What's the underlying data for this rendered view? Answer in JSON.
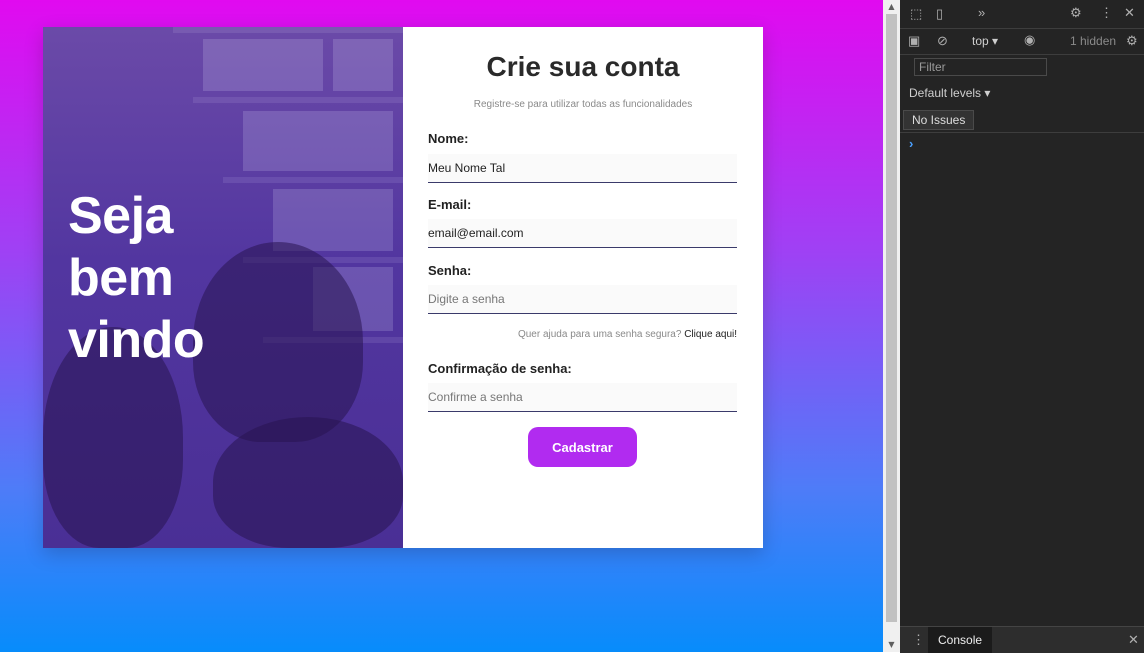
{
  "hero": {
    "title_lines": [
      "Seja",
      "bem",
      "vindo"
    ]
  },
  "form": {
    "title": "Crie sua conta",
    "subtitle": "Registre-se para utilizar todas as funcionalidades",
    "name_label": "Nome:",
    "name_value": "Meu Nome Tal",
    "email_label": "E-mail:",
    "email_value": "email@email.com",
    "password_label": "Senha:",
    "password_placeholder": "Digite a senha",
    "help_text": "Quer ajuda para uma senha segura?",
    "help_link": "Clique aqui!",
    "confirm_label": "Confirmação de senha:",
    "confirm_placeholder": "Confirme a senha",
    "submit_label": "Cadastrar",
    "accent_color": "#b12bf0"
  },
  "devtools": {
    "context": "top",
    "hidden_count": "1 hidden",
    "filter_placeholder": "Filter",
    "levels": "Default levels",
    "issues": "No Issues",
    "tab_console": "Console"
  }
}
